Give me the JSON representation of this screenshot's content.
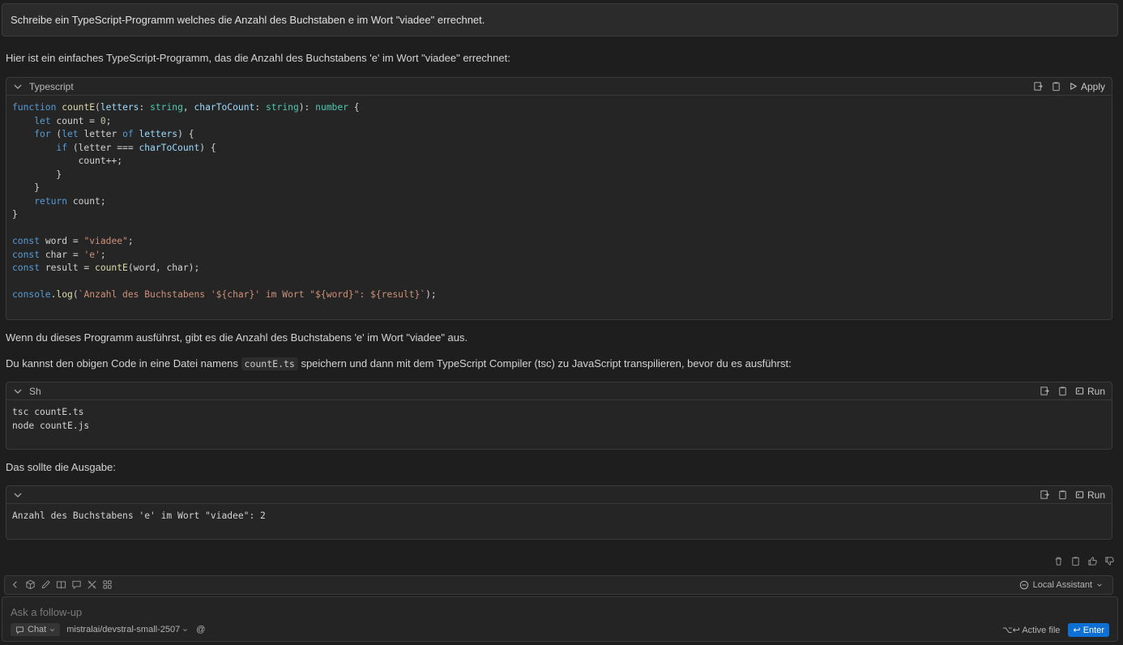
{
  "user_message": "Schreibe ein TypeScript-Programm welches die Anzahl des Buchstaben e im Wort \"viadee\" errechnet.",
  "intro": "Hier ist ein einfaches TypeScript-Programm, das die Anzahl des Buchstabens 'e' im Wort \"viadee\" errechnet:",
  "code_block_1": {
    "language": "Typescript",
    "action_label": "Apply",
    "lines": [
      "function countE(letters: string, charToCount: string): number {",
      "    let count = 0;",
      "    for (let letter of letters) {",
      "        if (letter === charToCount) {",
      "            count++;",
      "        }",
      "    }",
      "    return count;",
      "}",
      "",
      "const word = \"viadee\";",
      "const char = 'e';",
      "const result = countE(word, char);",
      "",
      "console.log(`Anzahl des Buchstabens '${char}' im Wort \"${word}\": ${result}`);"
    ]
  },
  "para_run": "Wenn du dieses Programm ausführst, gibt es die Anzahl des Buchstabens 'e' im Wort \"viadee\" aus.",
  "para_save": {
    "before": "Du kannst den obigen Code in eine Datei namens ",
    "code": "countE.ts",
    "after": " speichern und dann mit dem TypeScript Compiler (tsc) zu JavaScript transpilieren, bevor du es ausführst:"
  },
  "code_block_2": {
    "language": "Sh",
    "action_label": "Run",
    "lines": [
      "tsc countE.ts",
      "node countE.js"
    ]
  },
  "para_output": "Das sollte die Ausgabe:",
  "code_block_3": {
    "language": "",
    "action_label": "Run",
    "lines": [
      "Anzahl des Buchstabens 'e' im Wort \"viadee\": 2"
    ]
  },
  "toolbar": {
    "assistant_label": "Local Assistant"
  },
  "composer": {
    "placeholder": "Ask a follow-up",
    "mode_label": "Chat",
    "model_label": "mistralai/devstral-small-2507",
    "mention_symbol": "@",
    "active_file_label": "⌥↩ Active file",
    "enter_label": "↩ Enter"
  },
  "colors": {
    "accent": "#0e70d4",
    "background": "#1e1e1e"
  }
}
